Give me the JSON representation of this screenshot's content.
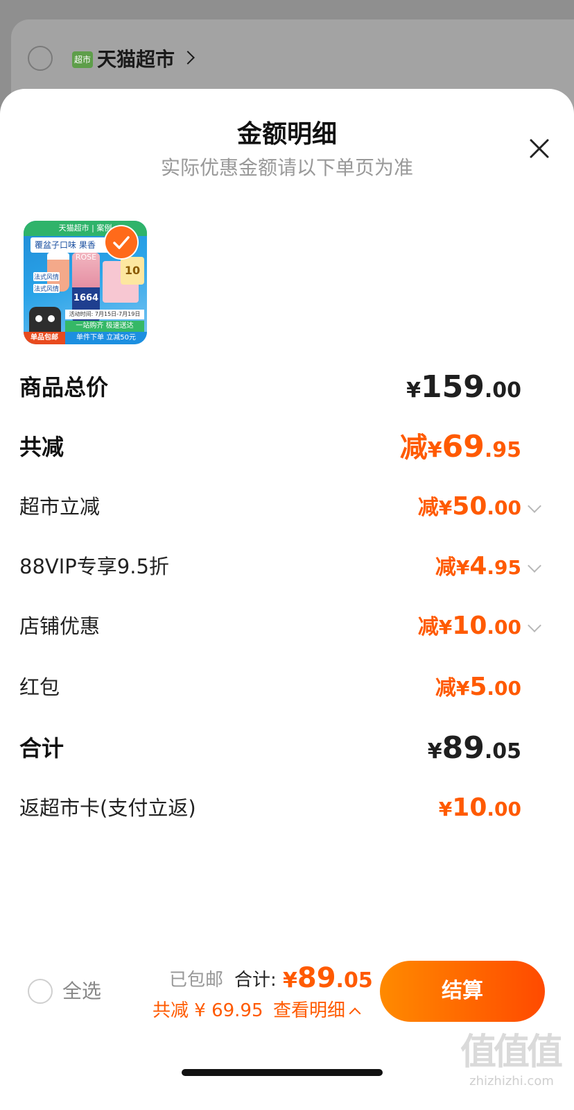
{
  "background": {
    "store_icon_text": "超市",
    "store_name": "天猫超市"
  },
  "sheet": {
    "title": "金额明细",
    "subtitle": "实际优惠金额请以下单页为准"
  },
  "product": {
    "thumb_header": "天猫超市 | 案例",
    "thumb_banner": "覆盆子口味 果香",
    "thumb_can_top": "ROSE",
    "thumb_can_text": "1664",
    "thumb_card_text": "10",
    "thumb_tags": [
      "法式风情",
      "法式风情"
    ],
    "thumb_strip": "活动时间: 7月15日-7月19日",
    "thumb_green": "一站购齐 极速送达",
    "thumb_bottom": "单件下单 立减50元",
    "thumb_badge": "单品包邮"
  },
  "rows": {
    "goods_total": {
      "label": "商品总价",
      "currency": "¥",
      "int": "159",
      "dec": ".00"
    },
    "total_discount": {
      "label": "共减",
      "prefix": "减",
      "currency": "¥",
      "int": "69",
      "dec": ".95"
    },
    "supermarket_discount": {
      "label": "超市立减",
      "prefix": "减",
      "currency": "¥",
      "int": "50",
      "dec": ".00"
    },
    "vip_discount": {
      "label": "88VIP专享9.5折",
      "prefix": "减",
      "currency": "¥",
      "int": "4",
      "dec": ".95"
    },
    "store_discount": {
      "label": "店铺优惠",
      "prefix": "减",
      "currency": "¥",
      "int": "10",
      "dec": ".00"
    },
    "red_packet": {
      "label": "红包",
      "prefix": "减",
      "currency": "¥",
      "int": "5",
      "dec": ".00"
    },
    "sum": {
      "label": "合计",
      "currency": "¥",
      "int": "89",
      "dec": ".05"
    },
    "cashback": {
      "label": "返超市卡(支付立返)",
      "currency": "¥",
      "int": "10",
      "dec": ".00"
    }
  },
  "footer": {
    "select_all": "全选",
    "shipping": "已包邮",
    "total_label": "合计:",
    "total_currency": "¥",
    "total_int": "89",
    "total_dec": ".05",
    "discount_text": "共减 ¥ 69.95",
    "detail_link": "查看明细",
    "checkout": "结算"
  },
  "watermark": {
    "glyphs": "值值值",
    "url": "zhizhizhi.com"
  },
  "colors": {
    "accent": "#ff5a00",
    "checkout_gradient_start": "#ff8a00",
    "checkout_gradient_end": "#ff4a00",
    "overlay": "#8f8f8f"
  }
}
